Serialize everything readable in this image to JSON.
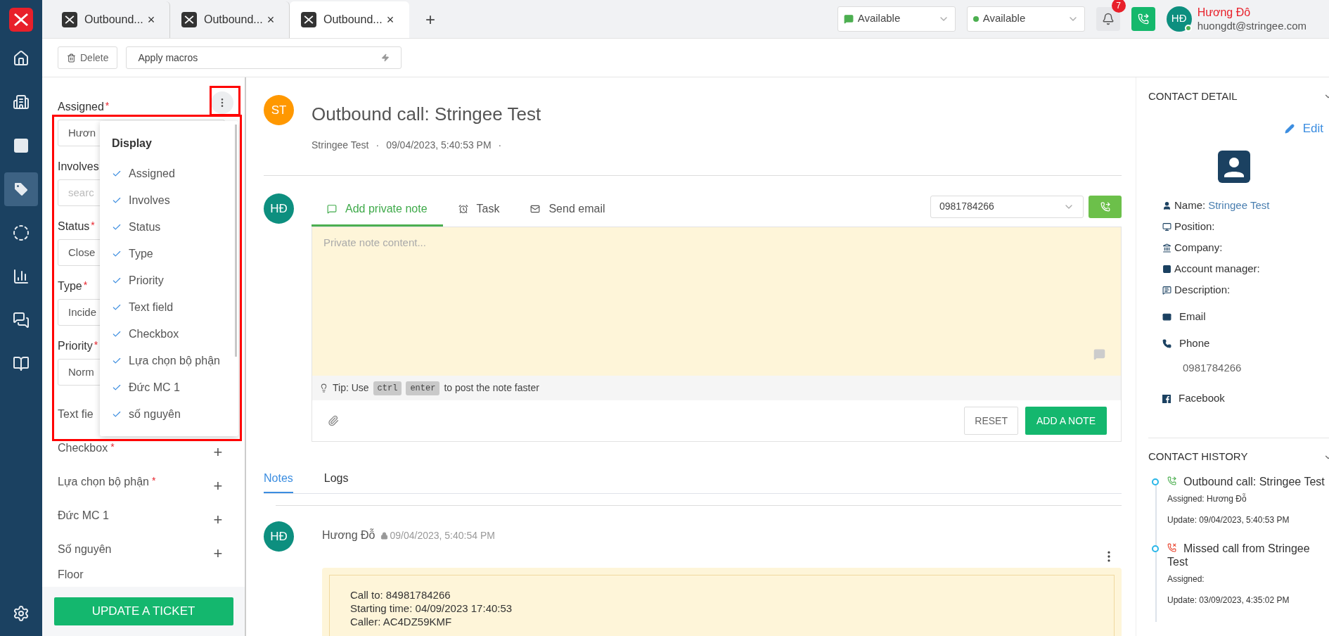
{
  "nav": [
    {
      "kind": "home",
      "selected": false
    },
    {
      "kind": "building",
      "selected": false
    },
    {
      "kind": "contact",
      "selected": false
    },
    {
      "kind": "tag",
      "selected": true
    },
    {
      "kind": "target",
      "selected": false
    },
    {
      "kind": "chart",
      "selected": false
    },
    {
      "kind": "chat",
      "selected": false
    },
    {
      "kind": "book",
      "selected": false
    },
    {
      "kind": "settings",
      "selected": false
    }
  ],
  "tabs": [
    {
      "label": "Outbound...",
      "close": "×",
      "selected": false
    },
    {
      "label": "Outbound...",
      "close": "×",
      "selected": false
    },
    {
      "label": "Outbound...",
      "close": "×",
      "selected": true
    }
  ],
  "new_tab": "+",
  "status_selects": [
    {
      "kind": "chat",
      "value": "Available"
    },
    {
      "kind": "dot",
      "value": "Available",
      "color": "#4caf50"
    }
  ],
  "notifications": {
    "count": "7"
  },
  "user": {
    "initials": "HĐ",
    "name": "Hương Đô",
    "email": "huongdt@stringee.com",
    "online": true
  },
  "toolbar": {
    "delete": "Delete",
    "macros_placeholder": "Apply macros"
  },
  "form": {
    "fields": [
      {
        "kind": "field",
        "label": "Assigned",
        "required": true,
        "marker": "*",
        "value": "Hươn"
      },
      {
        "kind": "field",
        "label": "Involves",
        "required": false,
        "placeholder": "searc"
      },
      {
        "kind": "field",
        "label": "Status",
        "required": true,
        "marker": "*",
        "value": "Close"
      },
      {
        "kind": "field",
        "label": "Type",
        "required": true,
        "marker": "*",
        "value": "Incide"
      },
      {
        "kind": "field",
        "label": "Priority",
        "required": true,
        "marker": "*",
        "value": "Norm"
      },
      {
        "kind": "expandable",
        "label": "Text fie",
        "required": false
      },
      {
        "kind": "expandable",
        "label": "Checkbox",
        "required": true,
        "marker": "*",
        "toggle": "+"
      },
      {
        "kind": "expandable",
        "label": "Lựa chọn bộ phận",
        "required": true,
        "marker": "*",
        "toggle": "+"
      },
      {
        "kind": "expandable",
        "label": "Đức MC 1",
        "required": false,
        "toggle": "+"
      },
      {
        "kind": "expandable",
        "label": "Số nguyên",
        "required": false,
        "toggle": "+"
      },
      {
        "kind": "expandable",
        "label": "Floor",
        "required": false
      }
    ],
    "submit": "UPDATE A TICKET"
  },
  "display_menu": {
    "title": "Display",
    "items": [
      {
        "label": "Assigned",
        "checked": true
      },
      {
        "label": "Involves",
        "checked": true
      },
      {
        "label": "Status",
        "checked": true
      },
      {
        "label": "Type",
        "checked": true
      },
      {
        "label": "Priority",
        "checked": true
      },
      {
        "label": "Text field",
        "checked": true
      },
      {
        "label": "Checkbox",
        "checked": true
      },
      {
        "label": "Lựa chọn bộ phận",
        "checked": true
      },
      {
        "label": "Đức MC 1",
        "checked": true
      },
      {
        "label": "số nguyên",
        "checked": true
      }
    ]
  },
  "ticket": {
    "initials": "ST",
    "title": "Outbound call: Stringee Test",
    "contact": "Stringee Test",
    "separator": "·",
    "time": "09/04/2023, 5:40:53 PM"
  },
  "composer": {
    "initials": "HĐ",
    "tabs": [
      {
        "kind": "note",
        "label": "Add private note",
        "selected": true
      },
      {
        "kind": "task",
        "label": "Task",
        "selected": false
      },
      {
        "kind": "email",
        "label": "Send email",
        "selected": false
      }
    ],
    "phone": "0981784266",
    "placeholder": "Private note content...",
    "tip": "Tip: Use",
    "keys": [
      "ctrl",
      "enter"
    ],
    "tip_end": "to post the note faster",
    "reset": "RESET",
    "submit": "ADD A NOTE"
  },
  "activity_tabs": [
    {
      "label": "Notes",
      "selected": true
    },
    {
      "label": "Logs",
      "selected": false
    }
  ],
  "note": {
    "initials": "HĐ",
    "author": "Hương Đỗ",
    "time": "09/04/2023, 5:40:54 PM",
    "lines": [
      "Call to: 84981784266",
      "Starting time: 04/09/2023 17:40:53",
      "Caller: AC4DZ59KMF"
    ]
  },
  "contact_detail": {
    "title": "CONTACT DETAIL",
    "edit": "Edit",
    "rows": [
      {
        "kind": "name",
        "label": "Name:",
        "value": "Stringee Test"
      },
      {
        "kind": "position",
        "label": "Position:"
      },
      {
        "kind": "company",
        "label": "Company:"
      },
      {
        "kind": "manager",
        "label": "Account manager:"
      },
      {
        "kind": "description",
        "label": "Description:"
      },
      {
        "kind": "email",
        "label": "Email"
      },
      {
        "kind": "phone",
        "label": "Phone",
        "value": "0981784266"
      },
      {
        "kind": "facebook",
        "label": "Facebook"
      }
    ]
  },
  "contact_history": {
    "title": "CONTACT HISTORY",
    "items": [
      {
        "kind": "outbound",
        "title": "Outbound call: Stringee Test",
        "assigned": "Assigned: Hương Đỗ",
        "update": "Update: 09/04/2023, 5:40:53 PM"
      },
      {
        "kind": "missed",
        "title": "Missed call from Stringee Test",
        "assigned": "Assigned:",
        "update": "Update: 03/09/2023, 4:35:02 PM"
      }
    ]
  }
}
